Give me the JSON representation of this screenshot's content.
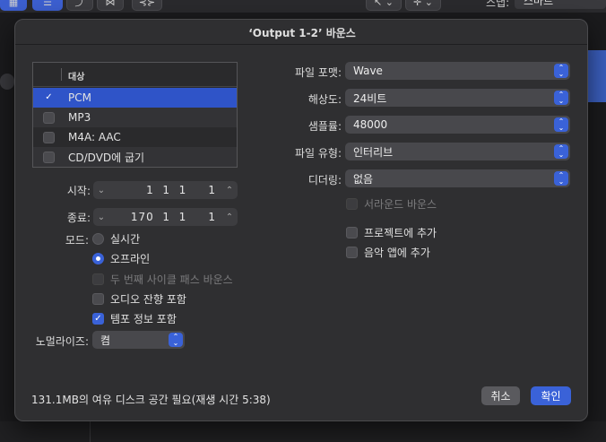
{
  "background": {
    "toolbar_label": "스냅:",
    "toolbar_value": "스마트"
  },
  "dialog": {
    "title": "‘Output 1-2’ 바운스",
    "destination": {
      "header": "대상",
      "items": [
        {
          "label": "PCM",
          "checked": true,
          "selected": true
        },
        {
          "label": "MP3",
          "checked": false
        },
        {
          "label": "M4A: AAC",
          "checked": false
        },
        {
          "label": "CD/DVD에 굽기",
          "checked": false
        }
      ]
    },
    "start": {
      "label": "시작:",
      "value": "1  1  1     1"
    },
    "end": {
      "label": "종료:",
      "value": "170  1  1     1"
    },
    "mode": {
      "label": "모드:",
      "options": [
        {
          "label": "실시간",
          "selected": false
        },
        {
          "label": "오프라인",
          "selected": true
        }
      ]
    },
    "options": {
      "cycle_bounce": {
        "label": "두 번째 사이클 패스 바운스",
        "checked": false,
        "enabled": false
      },
      "audio_tail": {
        "label": "오디오 잔향 포함",
        "checked": false
      },
      "tempo_info": {
        "label": "템포 정보 포함",
        "checked": true
      }
    },
    "normalize": {
      "label": "노멀라이즈:",
      "value": "켬"
    },
    "file_format": {
      "label": "파일 포맷:",
      "value": "Wave"
    },
    "resolution": {
      "label": "해상도:",
      "value": "24비트"
    },
    "sample_rate": {
      "label": "샘플률:",
      "value": "48000"
    },
    "file_type": {
      "label": "파일 유형:",
      "value": "인터리브"
    },
    "dithering": {
      "label": "디더링:",
      "value": "없음"
    },
    "surround_bounce": {
      "label": "서라운드 바운스",
      "checked": false,
      "enabled": false
    },
    "add_to_project": {
      "label": "프로젝트에 추가",
      "checked": false
    },
    "add_to_music": {
      "label": "음악 앱에 추가",
      "checked": false
    },
    "footer_text": "131.1MB의 여유 디스크 공간 필요(재생 시간 5:38)",
    "cancel_label": "취소",
    "ok_label": "확인"
  },
  "colors": {
    "accent": "#3a62d8",
    "dialog_bg": "#2f2f31",
    "selection": "#2f54c8"
  }
}
